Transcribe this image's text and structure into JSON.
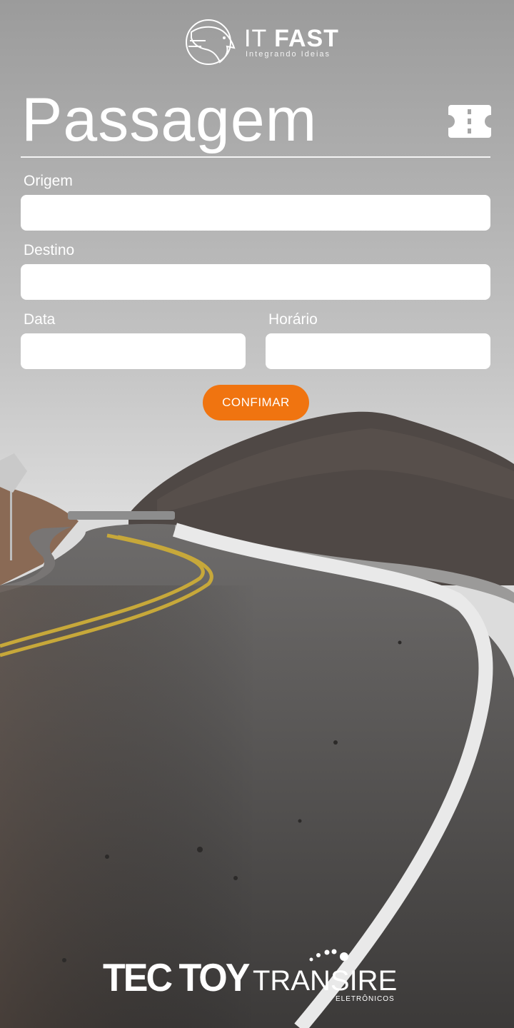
{
  "header": {
    "logo_brand_light": "IT",
    "logo_brand_bold": "FAST",
    "logo_tagline": "Integrando Ideias",
    "logo_icon": "eagle-icon"
  },
  "page": {
    "title": "Passagem",
    "title_icon": "ticket-icon"
  },
  "form": {
    "origin_label": "Origem",
    "origin_value": "",
    "destination_label": "Destino",
    "destination_value": "",
    "date_label": "Data",
    "date_value": "",
    "time_label": "Horário",
    "time_value": "",
    "confirm_label": "CONFIMAR"
  },
  "footer": {
    "sponsor1": "TEC TOY",
    "sponsor2": "TRANSIRE",
    "sponsor2_sub": "ELETRÔNICOS"
  },
  "colors": {
    "accent": "#f07410",
    "field_bg": "#ffffff",
    "text_light": "#ffffff"
  }
}
